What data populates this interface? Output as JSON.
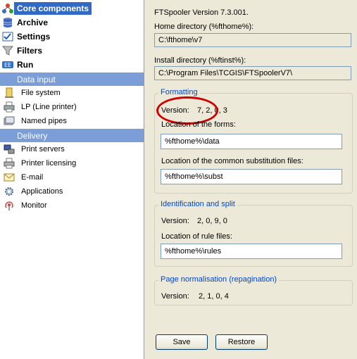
{
  "sidebar": {
    "top_items": [
      {
        "label": "Core components",
        "icon": "core-components-icon"
      },
      {
        "label": "Archive",
        "icon": "archive-icon"
      },
      {
        "label": "Settings",
        "icon": "settings-icon"
      },
      {
        "label": "Filters",
        "icon": "filter-icon"
      },
      {
        "label": "Run",
        "icon": "run-icon"
      }
    ],
    "sections": [
      {
        "label": "Data input"
      },
      {
        "label": "Delivery"
      }
    ],
    "data_input_items": [
      {
        "label": "File system",
        "icon": "file-system-icon"
      },
      {
        "label": "LP (Line printer)",
        "icon": "line-printer-icon"
      },
      {
        "label": "Named pipes",
        "icon": "named-pipes-icon"
      }
    ],
    "delivery_items": [
      {
        "label": "Print servers",
        "icon": "print-server-icon"
      },
      {
        "label": "Printer licensing",
        "icon": "printer-licensing-icon"
      },
      {
        "label": "E-mail",
        "icon": "email-icon"
      },
      {
        "label": "Applications",
        "icon": "applications-icon"
      },
      {
        "label": "Monitor",
        "icon": "monitor-icon"
      }
    ]
  },
  "main": {
    "version_title": "FTSpooler Version 7.3.001.",
    "home_dir_label": "Home directory (%fthome%):",
    "home_dir_value": "C:\\fthome\\v7",
    "install_dir_label": "Install directory (%ftinst%):",
    "install_dir_value": "C:\\Program Files\\TCGIS\\FTSpoolerV7\\",
    "formatting": {
      "title": "Formatting",
      "version_label": "Version:",
      "version_value": "7, 2, 0, 3",
      "forms_label": "Location of the forms:",
      "forms_value": "%fthome%\\data",
      "subst_label": "Location of the common substitution files:",
      "subst_value": "%fthome%\\subst"
    },
    "identification": {
      "title": "Identification and split",
      "version_label": "Version:",
      "version_value": "2, 0, 9, 0",
      "rules_label": "Location of rule files:",
      "rules_value": "%fthome%\\rules"
    },
    "normalisation": {
      "title": "Page normalisation (repagination)",
      "version_label": "Version:",
      "version_value": "2, 1, 0, 4"
    },
    "buttons": {
      "save": "Save",
      "restore": "Restore"
    }
  }
}
